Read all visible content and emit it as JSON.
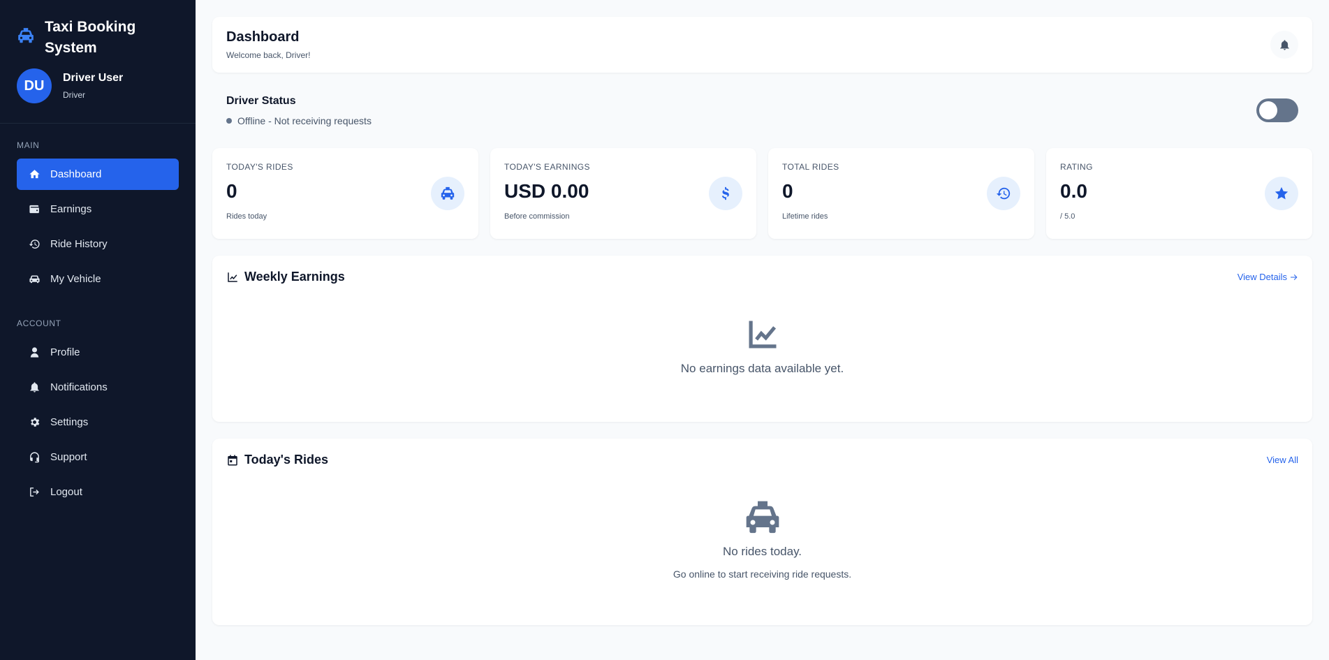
{
  "app": {
    "title": "Taxi Booking System"
  },
  "user": {
    "initials": "DU",
    "name": "Driver User",
    "role": "Driver"
  },
  "sidebar": {
    "main_label": "MAIN",
    "main_items": [
      {
        "label": "Dashboard",
        "icon": "home-icon",
        "active": true
      },
      {
        "label": "Earnings",
        "icon": "wallet-icon"
      },
      {
        "label": "Ride History",
        "icon": "history-icon"
      },
      {
        "label": "My Vehicle",
        "icon": "car-icon"
      }
    ],
    "account_label": "ACCOUNT",
    "account_items": [
      {
        "label": "Profile",
        "icon": "user-icon"
      },
      {
        "label": "Notifications",
        "icon": "bell-icon"
      },
      {
        "label": "Settings",
        "icon": "gear-icon"
      },
      {
        "label": "Support",
        "icon": "headset-icon"
      },
      {
        "label": "Logout",
        "icon": "logout-icon"
      }
    ]
  },
  "header": {
    "title": "Dashboard",
    "subtitle": "Welcome back, Driver!"
  },
  "driver_status": {
    "title": "Driver Status",
    "text": "Offline - Not receiving requests",
    "online": false
  },
  "stats": [
    {
      "label": "TODAY'S RIDES",
      "value": "0",
      "sub": "Rides today",
      "icon": "taxi-icon"
    },
    {
      "label": "TODAY'S EARNINGS",
      "value": "USD 0.00",
      "sub": "Before commission",
      "icon": "dollar-icon"
    },
    {
      "label": "TOTAL RIDES",
      "value": "0",
      "sub": "Lifetime rides",
      "icon": "history-icon"
    },
    {
      "label": "RATING",
      "value": "0.0",
      "sub": "/ 5.0",
      "icon": "star-icon"
    }
  ],
  "weekly": {
    "title": "Weekly Earnings",
    "link": "View Details",
    "empty": "No earnings data available yet."
  },
  "today_rides": {
    "title": "Today's Rides",
    "link": "View All",
    "empty": "No rides today.",
    "empty_sub": "Go online to start receiving ride requests."
  },
  "colors": {
    "sidebar_bg": "#0f172a",
    "accent": "#2563eb",
    "page_bg": "#f8fafc"
  }
}
